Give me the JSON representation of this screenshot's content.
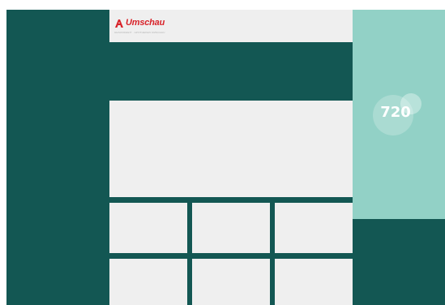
{
  "colors": {
    "primary_dark": "#135753",
    "panel_light": "#efefef",
    "accent_mint": "#92d1c6",
    "brand_red": "#d8232a"
  },
  "header": {
    "logo_text": "Umschau",
    "logo_icon": "pharmacy-a-icon",
    "tagline": "GESUNDHEIT · APOTHEKEN UMSCHAU"
  },
  "sidebar_badge": {
    "label": "720",
    "icon": "circle-badge-icon"
  }
}
